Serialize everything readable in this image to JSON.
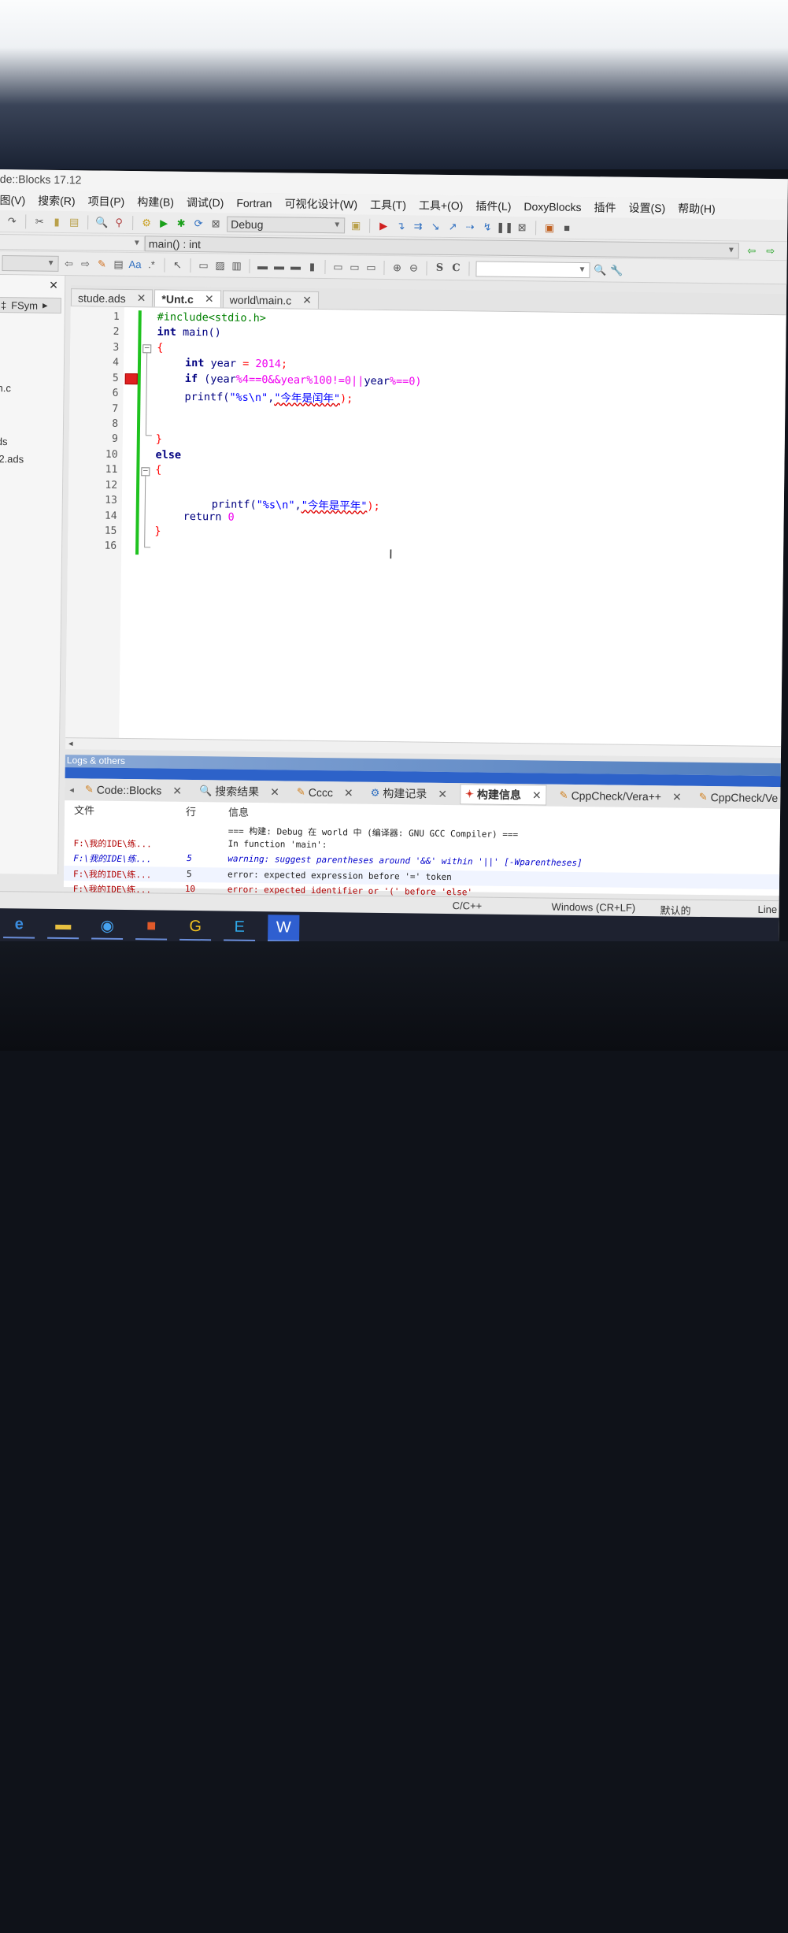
{
  "window": {
    "title": "de::Blocks 17.12"
  },
  "menu": [
    "图(V)",
    "搜索(R)",
    "项目(P)",
    "构建(B)",
    "调试(D)",
    "Fortran",
    "可视化设计(W)",
    "工具(T)",
    "工具+(O)",
    "插件(L)",
    "DoxyBlocks",
    "插件",
    "设置(S)",
    "帮助(H)"
  ],
  "toolbar": {
    "build_target": "Debug",
    "function_scope": "main() : int"
  },
  "mgmt_panel": {
    "tab_label": "FSym",
    "items": [
      "n.c",
      "ds",
      "l2.ads"
    ]
  },
  "editor": {
    "tabs": [
      {
        "label": "stude.ads",
        "active": false
      },
      {
        "label": "*Unt.c",
        "active": true
      },
      {
        "label": "world\\main.c",
        "active": false
      }
    ],
    "line_numbers": [
      "1",
      "2",
      "3",
      "4",
      "5",
      "6",
      "7",
      "8",
      "9",
      "10",
      "11",
      "12",
      "13",
      "14",
      "15",
      "16"
    ],
    "lines": {
      "l1": "#include<stdio.h>",
      "l2_kw": "int",
      "l2_rest": " main()",
      "l3": "{",
      "l4_kw": "int",
      "l4_a": " year ",
      "l4_op": "=",
      "l4_num": " 2014",
      "l4_end": ";",
      "l5_kw": "if",
      "l5_a": " (year",
      "l5_b": "%4==0&&year%100!=0||",
      "l5_c": "year",
      "l5_d": "%==0)",
      "l6_a": "printf(",
      "l6_str1": "\"%s\\n\"",
      "l6_b": ",",
      "l6_str2": "\"今年是闰年\"",
      "l6_end": ");",
      "l9": "}",
      "l10_kw": "else",
      "l11": "{",
      "l13_a": "printf(",
      "l13_str1": "\"%s\\n\"",
      "l13_b": ",",
      "l13_str2": "\"今年是平年\"",
      "l13_end": ");",
      "l14_a": "return",
      "l14_num": " 0",
      "l15": "}"
    }
  },
  "logs": {
    "title": "Logs & others",
    "tabs": [
      {
        "label": "Code::Blocks",
        "icon": "pencil"
      },
      {
        "label": "搜索结果",
        "icon": "search"
      },
      {
        "label": "Cccc",
        "icon": "pencil"
      },
      {
        "label": "构建记录",
        "icon": "gear"
      },
      {
        "label": "构建信息",
        "icon": "build",
        "active": true
      },
      {
        "label": "CppCheck/Vera++",
        "icon": "pencil"
      },
      {
        "label": "CppCheck/Ve",
        "icon": "pencil"
      }
    ],
    "headers": {
      "file": "文件",
      "line": "行",
      "message": "信息"
    },
    "rows": [
      {
        "file": "",
        "line": "",
        "message": "=== 构建: Debug 在 world 中 (编译器: GNU GCC Compiler) ===",
        "kind": "msg"
      },
      {
        "file": "F:\\我的IDE\\练...",
        "line": "",
        "message": "In function 'main':",
        "kind": "msg"
      },
      {
        "file": "F:\\我的IDE\\练...",
        "line": "5",
        "message": "warning: suggest parentheses around '&&' within '||' [-Wparentheses]",
        "kind": "warn"
      },
      {
        "file": "F:\\我的IDE\\练...",
        "line": "5",
        "message": "error: expected expression before '=' token",
        "kind": "msg"
      },
      {
        "file": "F:\\我的IDE\\练...",
        "line": "10",
        "message": "error: expected identifier or '(' before 'else'",
        "kind": "err"
      }
    ]
  },
  "status": {
    "language": "C/C++",
    "line_endings": "Windows (CR+LF)",
    "encoding": "默认的",
    "position": "Line"
  },
  "taskbar": [
    "edge-icon",
    "explorer-icon",
    "qq-browser-icon",
    "office-icon",
    "g-app-icon",
    "e-app-icon",
    "w-app-icon"
  ],
  "colors": {
    "keyword": "#000080",
    "string": "#0000ff",
    "number": "#f000f0",
    "preprocessor": "#008000",
    "changebar": "#1fc21f",
    "breakpoint": "#e02020"
  }
}
